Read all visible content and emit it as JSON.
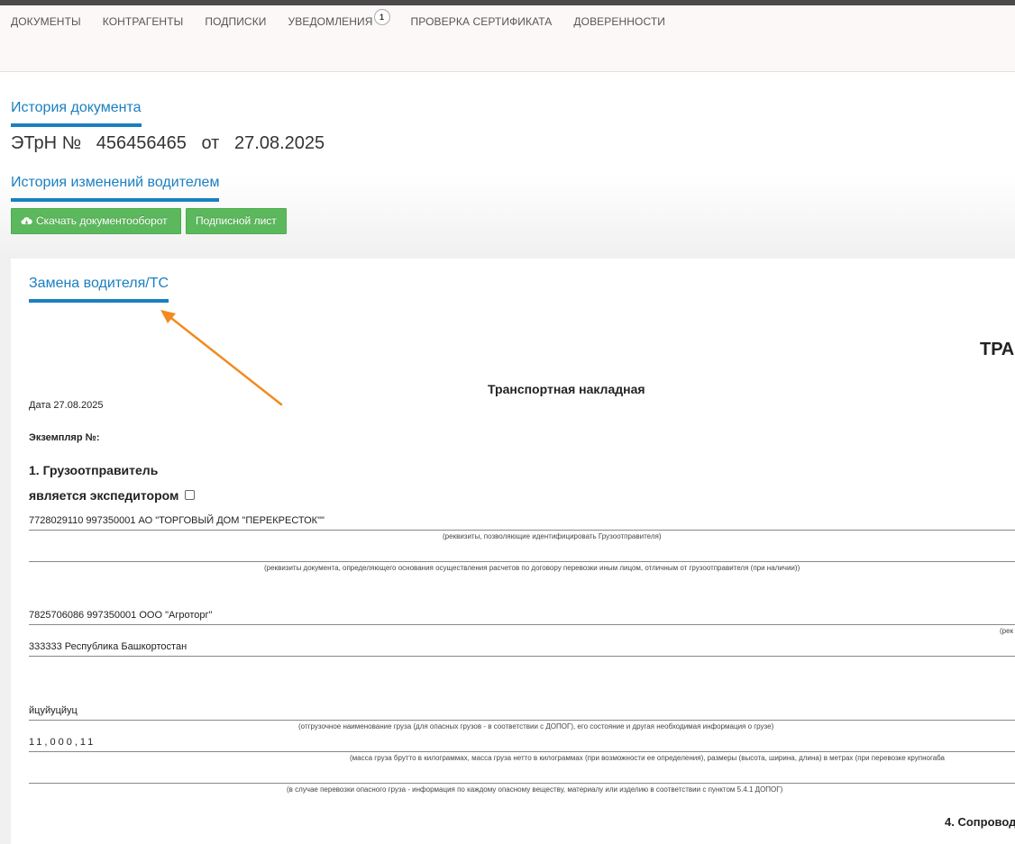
{
  "nav": {
    "items": [
      "ДОКУМЕНТЫ",
      "КОНТРАГЕНТЫ",
      "ПОДПИСКИ",
      "УВЕДОМЛЕНИЯ",
      "ПРОВЕРКА СЕРТИФИКАТА",
      "ДОВЕРЕННОСТИ"
    ],
    "notifications_badge": "1"
  },
  "header": {
    "history_link": "История документа",
    "doc_type": "ЭТрН №",
    "doc_number": "456456465",
    "date_prefix": "от",
    "doc_date": "27.08.2025",
    "driver_history_link": "История изменений водителем"
  },
  "buttons": {
    "download": "Скачать документооборот",
    "download_icon": "cloud-download-icon",
    "sign_sheet": "Подписной лист"
  },
  "panel": {
    "tab": "Замена водителя/ТС",
    "big_title_fragment": "ТРА",
    "title": "Транспортная накладная",
    "date_label": "Дата",
    "date_value": "27.08.2025",
    "copy_label": "Экземпляр №:",
    "section1": "1. Грузоотправитель",
    "expeditor_label": "является экспедитором",
    "shipper": "7728029110 997350001 АО \"ТОРГОВЫЙ ДОМ \"ПЕРЕКРЕСТОК\"\"",
    "shipper_hint": "(реквизиты, позволяющие идентифицировать Грузоотправителя)",
    "payment_hint": "(реквизиты документа, определяющего основания осуществления расчетов по договору перевозки иным лицом, отличным от грузоотправителя (при наличии))",
    "consignee": "7825706086 997350001 ООО \"Агроторг\"",
    "consignee_hint_fragment": "(рек",
    "address": "333333 Республика Башкортостан",
    "cargo_name": "йцуйуцйуц",
    "cargo_hint": "(отгрузочное наименование груза (для опасных грузов - в соответствии с ДОПОГ), его состояние и другая необходимая информация о грузе)",
    "mass": "11,000,11",
    "mass_hint": "(масса груза брутто в килограммах, масса груза нетто в килограммах (при возможности ее определения), размеры (высота, ширина, длина) в метрах (при перевозке крупногаба",
    "danger_hint": "(в случае перевозки опасного груза - информация по каждому опасному веществу, материалу или изделию в соответствии с пунктом 5.4.1 ДОПОГ)",
    "section4_fragment": "4. Сопровод"
  },
  "colors": {
    "accent_blue": "#1a7fc1",
    "button_green": "#5cb85c",
    "arrow_orange": "#f28a1f"
  }
}
